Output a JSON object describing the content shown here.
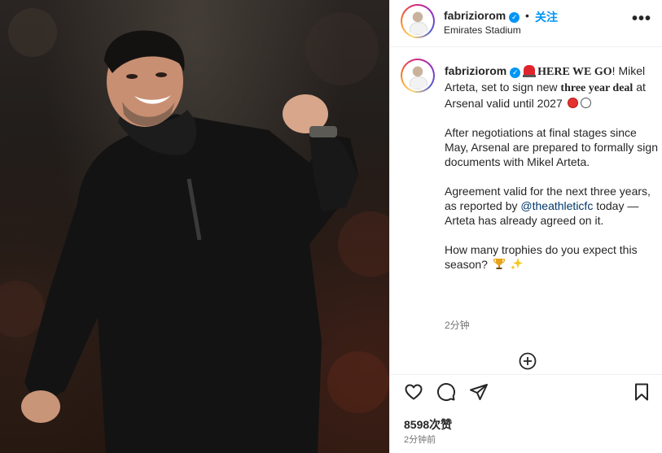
{
  "header": {
    "username": "fabriziorom",
    "separator": "•",
    "follow_label": "关注",
    "location": "Emirates Stadium",
    "more_label": "•••"
  },
  "caption": {
    "username": "fabriziorom",
    "headline": "HERE WE GO",
    "exclaim": "!",
    "line1_pre": "Mikel Arteta, set to sign new ",
    "line1_bold": "three year deal",
    "line1_post": " at Arsenal valid until 2027",
    "para2": "After negotiations at final stages since May, Arsenal are prepared to formally sign documents with Mikel Arteta.",
    "para3_pre": "Agreement valid for the next three years, as reported by ",
    "para3_link": "@theathleticfc",
    "para3_post": " today — Arteta has already agreed on it.",
    "para4": "How many trophies do you expect this season?",
    "time": "2分钟"
  },
  "footer": {
    "likes": "8598次赞",
    "date": "2分钟前"
  },
  "icons": {
    "like": "heart-icon",
    "comment": "comment-icon",
    "share": "send-icon",
    "save": "bookmark-icon",
    "add": "plus-circle-icon",
    "more": "more-horizontal-icon",
    "verified": "verified-badge-icon"
  },
  "colors": {
    "accent": "#0095f6",
    "link": "#00376b",
    "text": "#262626",
    "muted": "#737373"
  }
}
